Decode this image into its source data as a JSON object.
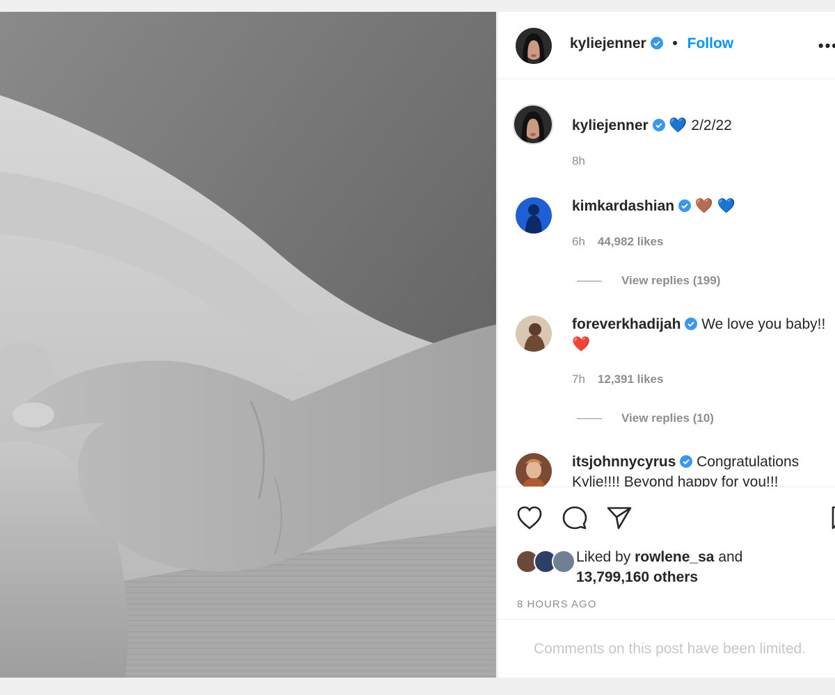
{
  "post": {
    "author": "kyliejenner",
    "follow_label": "Follow",
    "separator": "•",
    "more_label": "•••"
  },
  "caption": {
    "username": "kyliejenner",
    "emoji": "💙",
    "text": "2/2/22",
    "time": "8h"
  },
  "comments": [
    {
      "username": "kimkardashian",
      "text": "🤎 💙",
      "time": "6h",
      "likes": "44,982 likes",
      "replies": "View replies (199)"
    },
    {
      "username": "foreverkhadijah",
      "text": "We love you baby!!",
      "emoji": "❤️",
      "time": "7h",
      "likes": "12,391 likes",
      "replies": "View replies (10)"
    },
    {
      "username": "itsjohnnycyrus",
      "text": "Congratulations Kylie!!!! Beyond happy for you!!!"
    }
  ],
  "likes": {
    "prefix": "Liked by",
    "user": "rowlene_sa",
    "middle": "and",
    "count": "13,799,160 others"
  },
  "timestamp": "8 HOURS AGO",
  "limited_notice": "Comments on this post have been limited.",
  "icons": {
    "like": "heart-icon",
    "comment": "comment-icon",
    "share": "paper-plane-icon",
    "save": "bookmark-icon",
    "verified": "verified-badge-icon"
  },
  "colors": {
    "accent": "#0095f6",
    "verified": "#3897f0",
    "muted": "#8e8e8e"
  }
}
